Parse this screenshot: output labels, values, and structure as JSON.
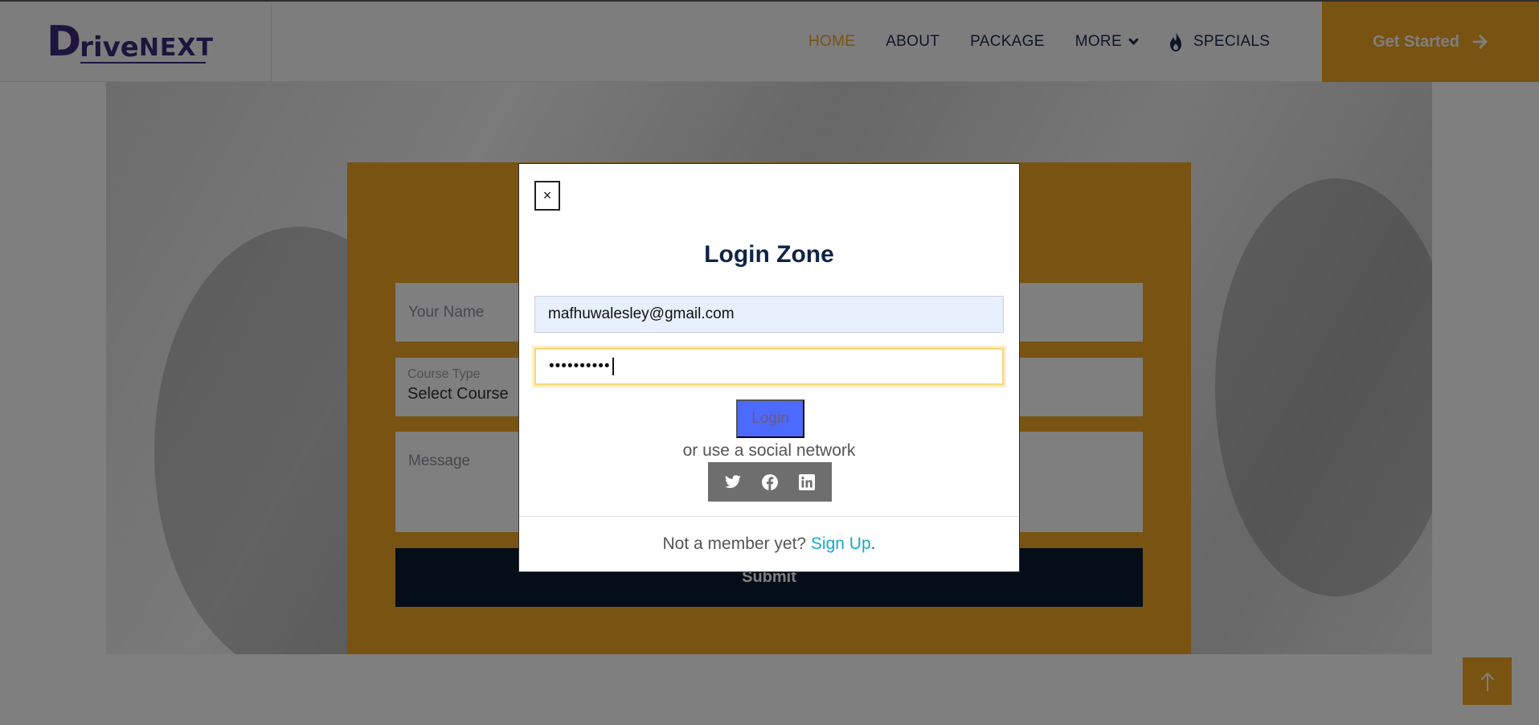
{
  "header": {
    "logo_first": "D",
    "logo_mid": "rive",
    "logo_rest": "NEXT",
    "nav": [
      {
        "label": "HOME"
      },
      {
        "label": "ABOUT"
      },
      {
        "label": "PACKAGE"
      },
      {
        "label": "MORE"
      },
      {
        "label": "SPECIALS"
      }
    ],
    "cta_label": "Get Started",
    "accent_color": "#f0a623",
    "brand_color": "#3b2a7c"
  },
  "form": {
    "name_placeholder": "Your Name",
    "course_label": "Course Type",
    "course_value": "Select Course",
    "message_placeholder": "Message",
    "submit_label": "Submit"
  },
  "modal": {
    "close_label": "×",
    "title": "Login Zone",
    "email_value": "mafhuwalesley@gmail.com",
    "password_value": "••••••••••",
    "login_label": "Login",
    "alt_text": "or use a social network",
    "social": [
      "twitter-icon",
      "facebook-icon",
      "linkedin-icon"
    ],
    "footer_text": "Not a member yet? ",
    "signup_label": "Sign Up",
    "footer_end": "."
  }
}
